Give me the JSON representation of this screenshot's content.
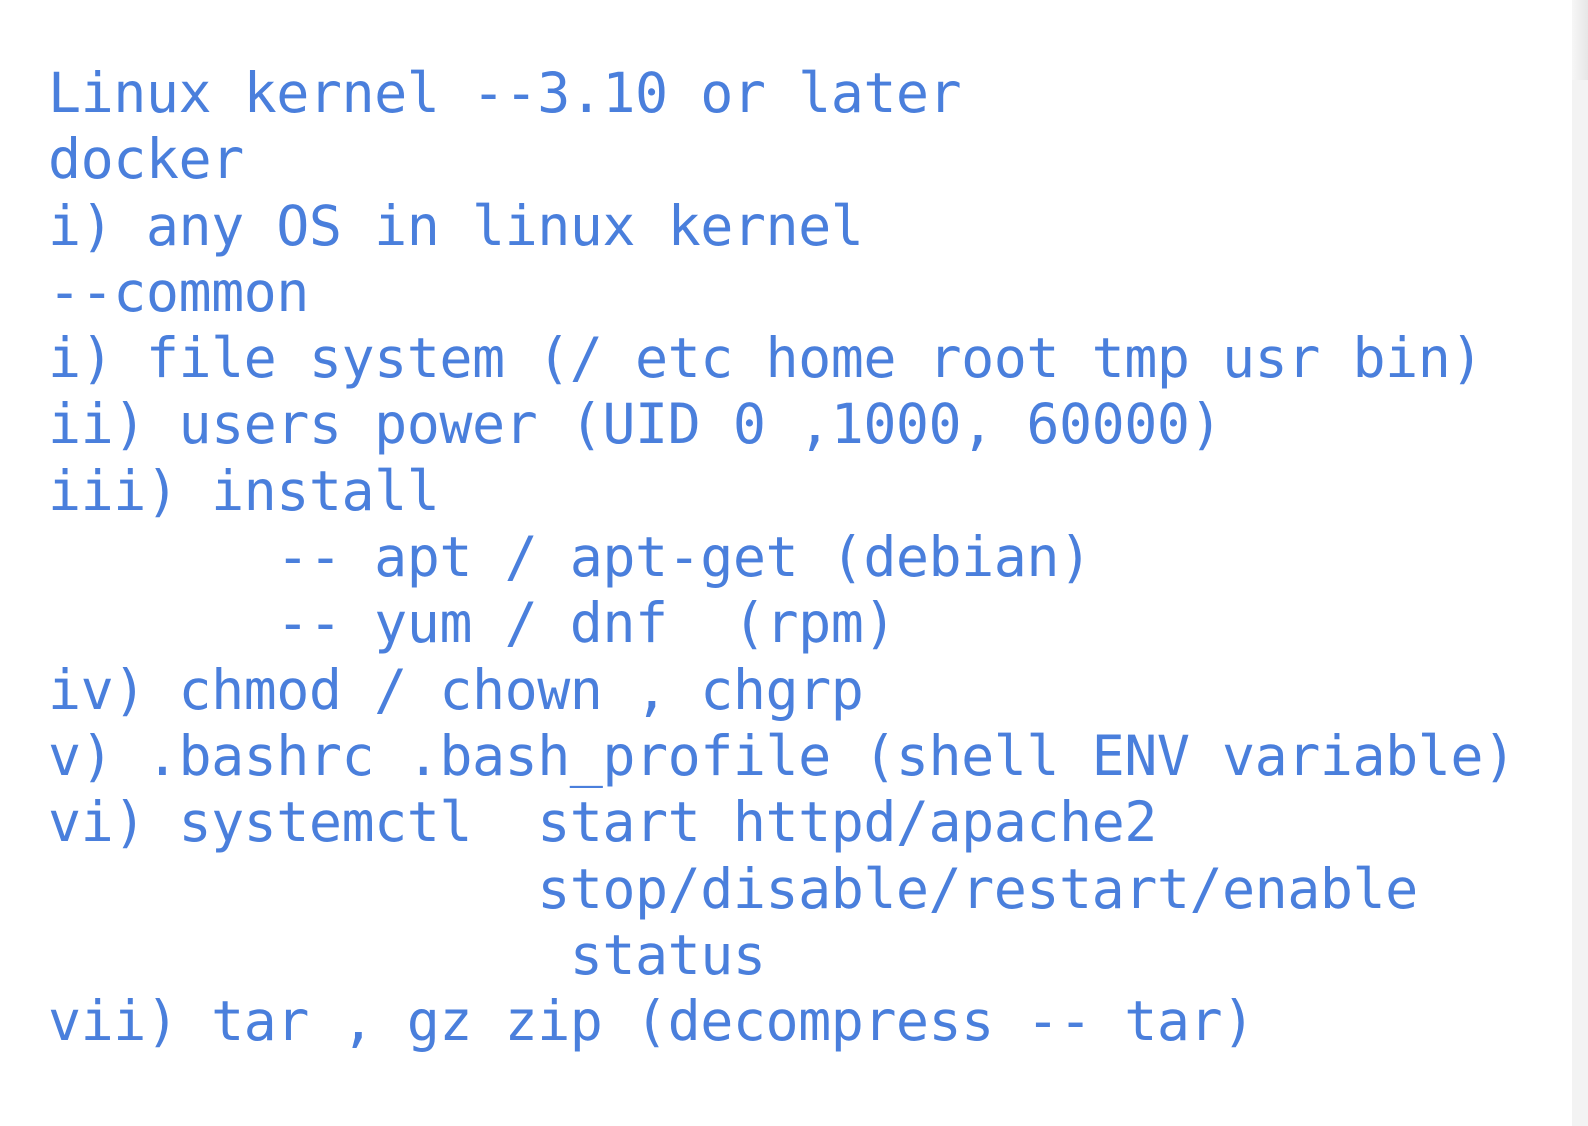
{
  "document": {
    "lines": [
      "Linux kernel --3.10 or later",
      "docker",
      "i) any OS in linux kernel",
      "--common",
      "i) file system (/ etc home root tmp usr bin)",
      "ii) users power (UID 0 ,1000, 60000)",
      "iii) install",
      "       -- apt / apt-get (debian)",
      "       -- yum / dnf  (rpm)",
      "iv) chmod / chown , chgrp",
      "v) .bashrc .bash_profile (shell ENV variable)",
      "vi) systemctl  start httpd/apache2",
      "               stop/disable/restart/enable",
      "                status",
      "vii) tar , gz zip (decompress -- tar)"
    ]
  },
  "theme": {
    "text_color": "#4a7fdc",
    "background": "#ffffff"
  }
}
